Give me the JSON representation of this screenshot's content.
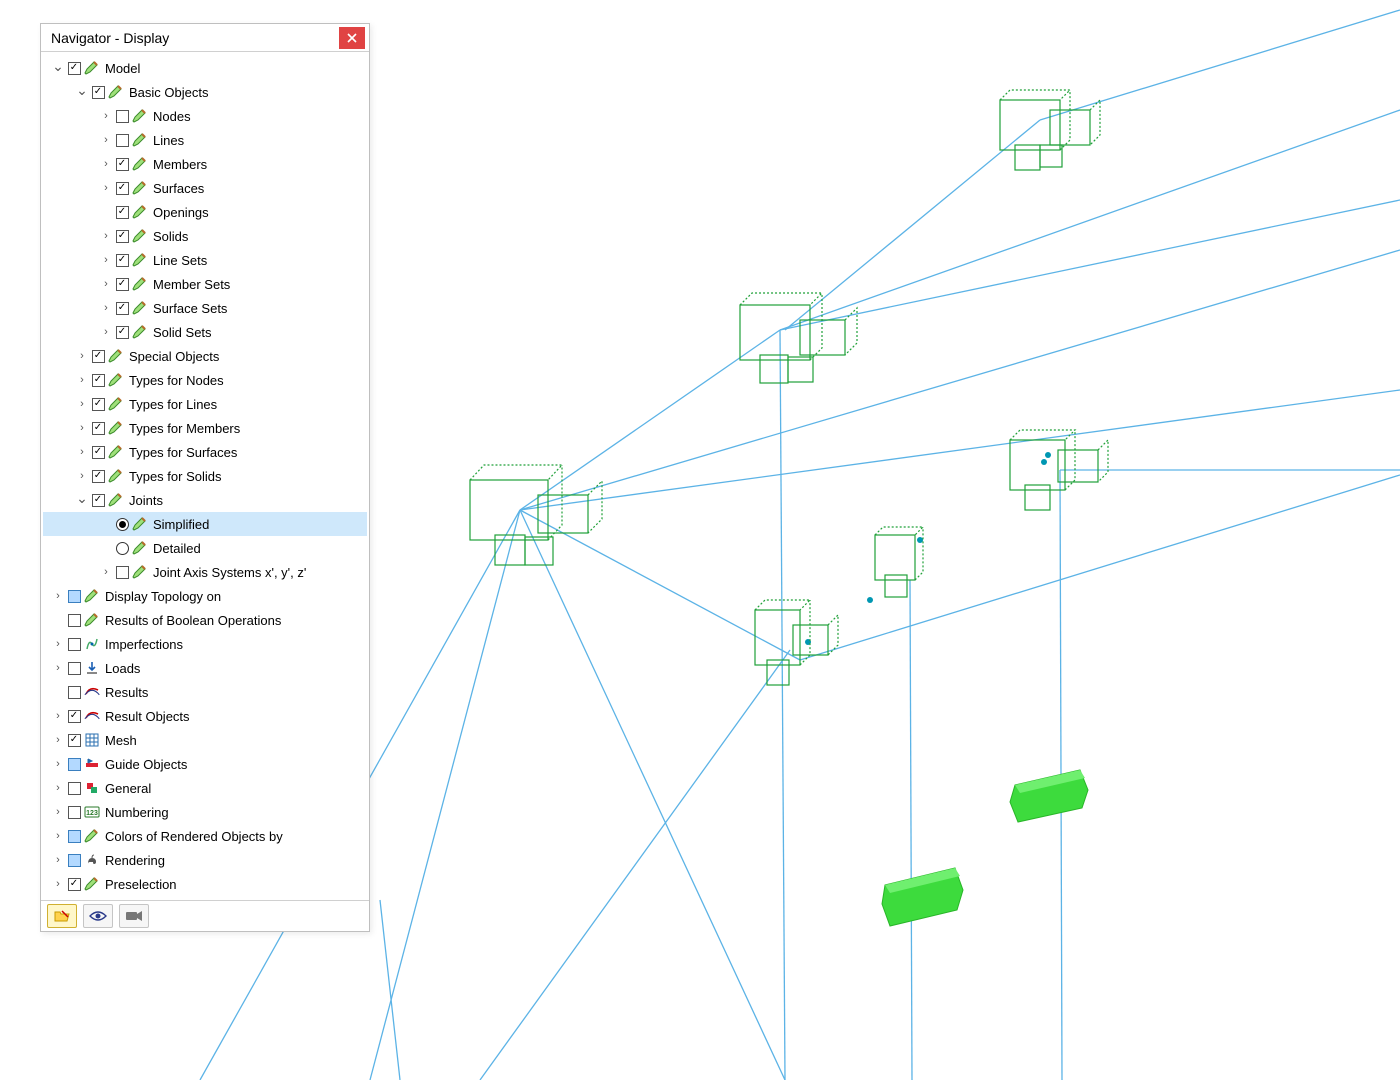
{
  "panel": {
    "title": "Navigator - Display"
  },
  "tree": [
    {
      "id": "model",
      "depth": 0,
      "chev": "down",
      "control": "check",
      "checked": true,
      "icon": "pencil",
      "label": "Model"
    },
    {
      "id": "basic",
      "depth": 1,
      "chev": "down",
      "control": "check",
      "checked": true,
      "icon": "pencil",
      "label": "Basic Objects"
    },
    {
      "id": "nodes",
      "depth": 2,
      "chev": "right",
      "control": "check",
      "checked": false,
      "icon": "pencil",
      "label": "Nodes"
    },
    {
      "id": "lines",
      "depth": 2,
      "chev": "right",
      "control": "check",
      "checked": false,
      "icon": "pencil",
      "label": "Lines"
    },
    {
      "id": "members",
      "depth": 2,
      "chev": "right",
      "control": "check",
      "checked": true,
      "icon": "pencil",
      "label": "Members"
    },
    {
      "id": "surfaces",
      "depth": 2,
      "chev": "right",
      "control": "check",
      "checked": true,
      "icon": "pencil",
      "label": "Surfaces"
    },
    {
      "id": "openings",
      "depth": 2,
      "chev": "none",
      "control": "check",
      "checked": true,
      "icon": "pencil",
      "label": "Openings"
    },
    {
      "id": "solids",
      "depth": 2,
      "chev": "right",
      "control": "check",
      "checked": true,
      "icon": "pencil",
      "label": "Solids"
    },
    {
      "id": "linesets",
      "depth": 2,
      "chev": "right",
      "control": "check",
      "checked": true,
      "icon": "pencil",
      "label": "Line Sets"
    },
    {
      "id": "membersets",
      "depth": 2,
      "chev": "right",
      "control": "check",
      "checked": true,
      "icon": "pencil",
      "label": "Member Sets"
    },
    {
      "id": "surfacesets",
      "depth": 2,
      "chev": "right",
      "control": "check",
      "checked": true,
      "icon": "pencil",
      "label": "Surface Sets"
    },
    {
      "id": "solidsets",
      "depth": 2,
      "chev": "right",
      "control": "check",
      "checked": true,
      "icon": "pencil",
      "label": "Solid Sets"
    },
    {
      "id": "special",
      "depth": 1,
      "chev": "right",
      "control": "check",
      "checked": true,
      "icon": "pencil",
      "label": "Special Objects"
    },
    {
      "id": "tnodes",
      "depth": 1,
      "chev": "right",
      "control": "check",
      "checked": true,
      "icon": "pencil",
      "label": "Types for Nodes"
    },
    {
      "id": "tlines",
      "depth": 1,
      "chev": "right",
      "control": "check",
      "checked": true,
      "icon": "pencil",
      "label": "Types for Lines"
    },
    {
      "id": "tmembers",
      "depth": 1,
      "chev": "right",
      "control": "check",
      "checked": true,
      "icon": "pencil",
      "label": "Types for Members"
    },
    {
      "id": "tsurfaces",
      "depth": 1,
      "chev": "right",
      "control": "check",
      "checked": true,
      "icon": "pencil",
      "label": "Types for Surfaces"
    },
    {
      "id": "tsolids",
      "depth": 1,
      "chev": "right",
      "control": "check",
      "checked": true,
      "icon": "pencil",
      "label": "Types for Solids"
    },
    {
      "id": "joints",
      "depth": 1,
      "chev": "down",
      "control": "check",
      "checked": true,
      "icon": "pencil",
      "label": "Joints"
    },
    {
      "id": "simplified",
      "depth": 2,
      "chev": "none",
      "control": "radio",
      "checked": true,
      "icon": "pencil",
      "label": "Simplified",
      "selected": true
    },
    {
      "id": "detailed",
      "depth": 2,
      "chev": "none",
      "control": "radio",
      "checked": false,
      "icon": "pencil",
      "label": "Detailed"
    },
    {
      "id": "jaxis",
      "depth": 2,
      "chev": "right",
      "control": "check",
      "checked": false,
      "icon": "pencil",
      "label": "Joint Axis Systems x', y', z'"
    },
    {
      "id": "dtopo",
      "depth": 0,
      "chev": "right",
      "control": "bluecheck",
      "checked": false,
      "icon": "pencil",
      "label": "Display Topology on"
    },
    {
      "id": "rbool",
      "depth": 0,
      "chev": "none",
      "control": "check",
      "checked": false,
      "icon": "pencil",
      "label": "Results of Boolean Operations"
    },
    {
      "id": "imperf",
      "depth": 0,
      "chev": "right",
      "control": "check",
      "checked": false,
      "icon": "imperf",
      "label": "Imperfections"
    },
    {
      "id": "loads",
      "depth": 0,
      "chev": "right",
      "control": "check",
      "checked": false,
      "icon": "loads",
      "label": "Loads"
    },
    {
      "id": "results",
      "depth": 0,
      "chev": "none",
      "control": "check",
      "checked": false,
      "icon": "results",
      "label": "Results"
    },
    {
      "id": "resobj",
      "depth": 0,
      "chev": "right",
      "control": "check",
      "checked": true,
      "icon": "results",
      "label": "Result Objects"
    },
    {
      "id": "mesh",
      "depth": 0,
      "chev": "right",
      "control": "check",
      "checked": true,
      "icon": "mesh",
      "label": "Mesh"
    },
    {
      "id": "guide",
      "depth": 0,
      "chev": "right",
      "control": "bluecheck",
      "checked": false,
      "icon": "guide",
      "label": "Guide Objects"
    },
    {
      "id": "general",
      "depth": 0,
      "chev": "right",
      "control": "check",
      "checked": false,
      "icon": "general",
      "label": "General"
    },
    {
      "id": "numbering",
      "depth": 0,
      "chev": "right",
      "control": "check",
      "checked": false,
      "icon": "numbering",
      "label": "Numbering"
    },
    {
      "id": "colors",
      "depth": 0,
      "chev": "right",
      "control": "bluecheck",
      "checked": false,
      "icon": "pencil",
      "label": "Colors of Rendered Objects by"
    },
    {
      "id": "rendering",
      "depth": 0,
      "chev": "right",
      "control": "bluecheck",
      "checked": false,
      "icon": "rendering",
      "label": "Rendering"
    },
    {
      "id": "presel",
      "depth": 0,
      "chev": "right",
      "control": "check",
      "checked": true,
      "icon": "pencil",
      "label": "Preselection"
    }
  ],
  "footer": {
    "active_tab": 0,
    "buttons": [
      "folder",
      "eye",
      "camera"
    ]
  }
}
